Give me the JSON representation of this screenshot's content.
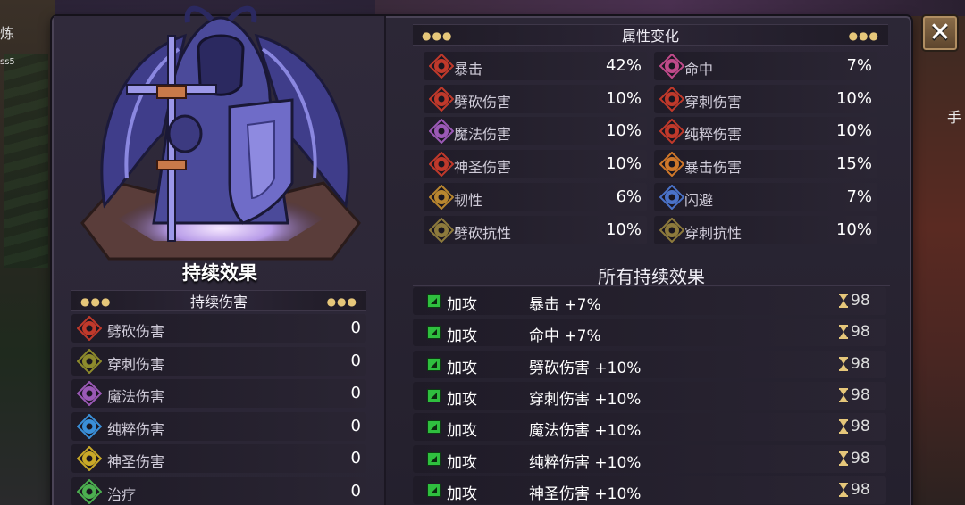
{
  "window": {
    "close_label": "✕"
  },
  "side": {
    "left_label": "炼",
    "left_sub": "ss5",
    "right_label": "手"
  },
  "hero": {
    "name": "持续效果"
  },
  "dot_section": {
    "title": "持续伤害",
    "items": [
      {
        "label": "劈砍伤害",
        "value": "0",
        "color": "#c0392b",
        "icon": "slash-damage-icon"
      },
      {
        "label": "穿刺伤害",
        "value": "0",
        "color": "#8d8a2c",
        "icon": "pierce-damage-icon"
      },
      {
        "label": "魔法伤害",
        "value": "0",
        "color": "#9b59b6",
        "icon": "magic-damage-icon"
      },
      {
        "label": "纯粹伤害",
        "value": "0",
        "color": "#3a8fd8",
        "icon": "pure-damage-icon"
      },
      {
        "label": "神圣伤害",
        "value": "0",
        "color": "#c9a928",
        "icon": "holy-damage-icon"
      },
      {
        "label": "治疗",
        "value": "0",
        "color": "#4caf50",
        "icon": "heal-icon"
      }
    ]
  },
  "attr_section": {
    "title": "属性变化",
    "left": [
      {
        "label": "暴击",
        "value": "42%",
        "color": "#c0392b",
        "icon": "crit-icon"
      },
      {
        "label": "劈砍伤害",
        "value": "10%",
        "color": "#c0392b",
        "icon": "slash-damage-icon"
      },
      {
        "label": "魔法伤害",
        "value": "10%",
        "color": "#9b59b6",
        "icon": "magic-damage-icon"
      },
      {
        "label": "神圣伤害",
        "value": "10%",
        "color": "#c0392b",
        "icon": "holy-damage-icon"
      },
      {
        "label": "韧性",
        "value": "6%",
        "color": "#b8862f",
        "icon": "toughness-icon"
      },
      {
        "label": "劈砍抗性",
        "value": "10%",
        "color": "#8d7a3c",
        "icon": "slash-resist-icon"
      }
    ],
    "right": [
      {
        "label": "命中",
        "value": "7%",
        "color": "#c04a8a",
        "icon": "accuracy-icon"
      },
      {
        "label": "穿刺伤害",
        "value": "10%",
        "color": "#c0392b",
        "icon": "pierce-damage-icon"
      },
      {
        "label": "纯粹伤害",
        "value": "10%",
        "color": "#c0392b",
        "icon": "pure-damage-icon"
      },
      {
        "label": "暴击伤害",
        "value": "15%",
        "color": "#d0782a",
        "icon": "crit-damage-icon"
      },
      {
        "label": "闪避",
        "value": "7%",
        "color": "#4a72c8",
        "icon": "dodge-icon"
      },
      {
        "label": "穿刺抗性",
        "value": "10%",
        "color": "#8d7a3c",
        "icon": "pierce-resist-icon"
      }
    ]
  },
  "effects_section": {
    "title": "所有持续效果",
    "items": [
      {
        "type": "加攻",
        "desc": "暴击 +7%",
        "duration": "98"
      },
      {
        "type": "加攻",
        "desc": "命中 +7%",
        "duration": "98"
      },
      {
        "type": "加攻",
        "desc": "劈砍伤害 +10%",
        "duration": "98"
      },
      {
        "type": "加攻",
        "desc": "穿刺伤害 +10%",
        "duration": "98"
      },
      {
        "type": "加攻",
        "desc": "魔法伤害 +10%",
        "duration": "98"
      },
      {
        "type": "加攻",
        "desc": "纯粹伤害 +10%",
        "duration": "98"
      },
      {
        "type": "加攻",
        "desc": "神圣伤害 +10%",
        "duration": "98"
      }
    ]
  },
  "colors": {
    "buff_green": "#2fbf3f",
    "gold_dots": "#e6c77a",
    "panel": "#2c2736"
  }
}
